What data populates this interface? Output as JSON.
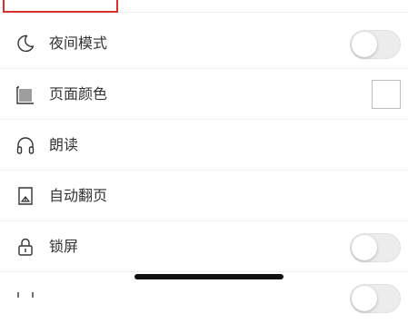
{
  "menu": {
    "items": [
      {
        "label": "夜间模式",
        "icon": "moon-icon",
        "control": "toggle",
        "on": false
      },
      {
        "label": "页面颜色",
        "icon": "page-color-icon",
        "control": "color-swatch",
        "color": "#ffffff"
      },
      {
        "label": "朗读",
        "icon": "headphones-icon",
        "control": "none"
      },
      {
        "label": "自动翻页",
        "icon": "auto-page-turn-icon",
        "control": "none"
      },
      {
        "label": "锁屏",
        "icon": "lock-icon",
        "control": "toggle",
        "on": false
      }
    ]
  },
  "colors": {
    "highlight": "#d9302c",
    "toggle_track": "#ececec",
    "text": "#333333"
  }
}
